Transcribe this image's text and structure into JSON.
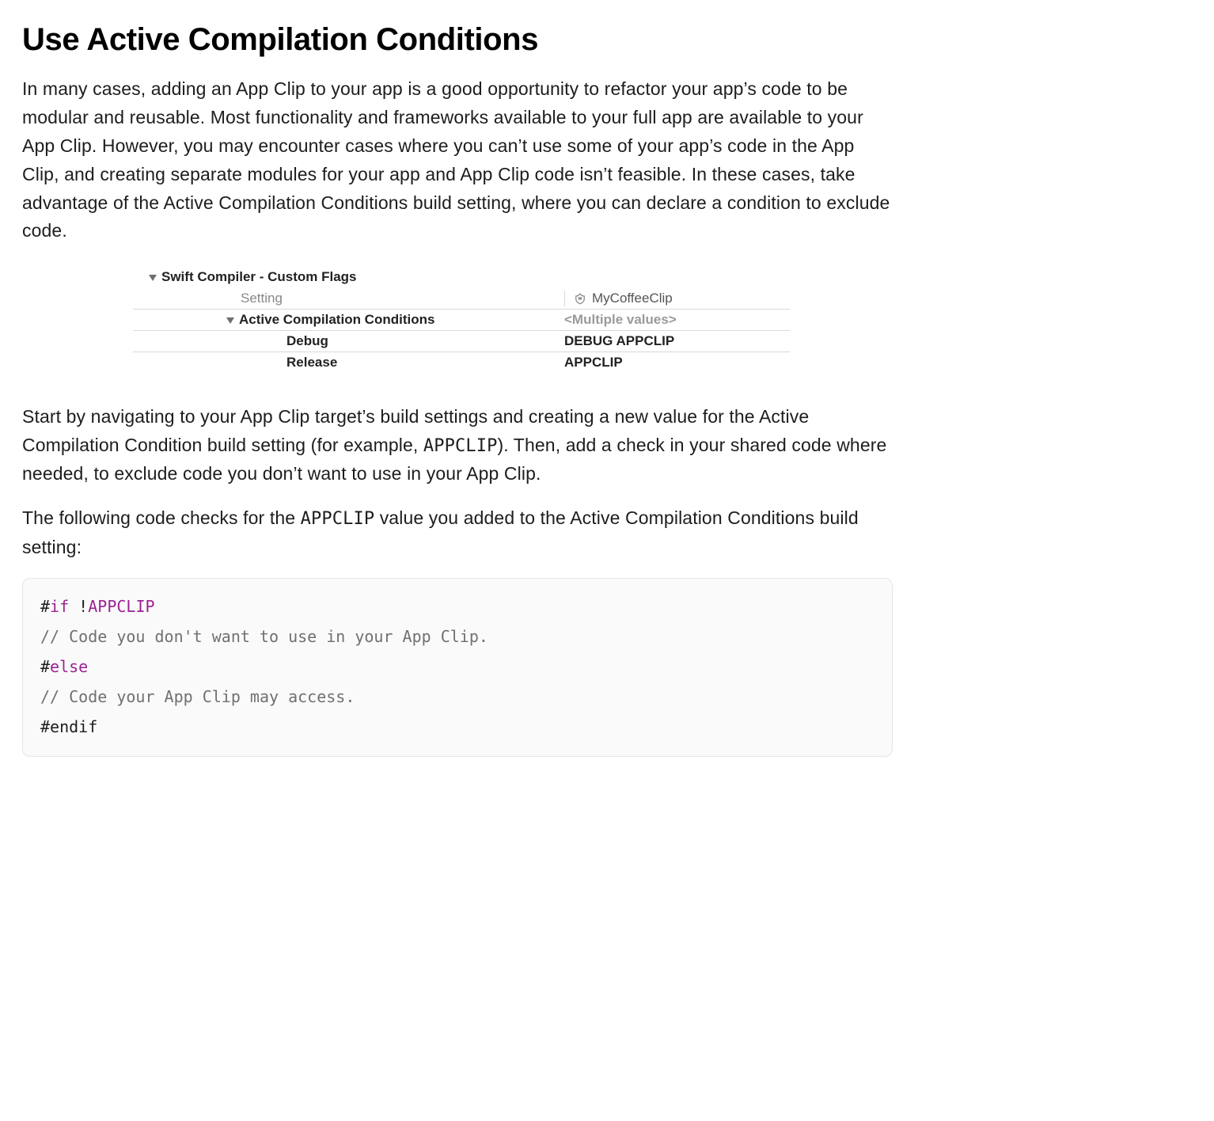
{
  "heading": "Use Active Compilation Conditions",
  "para1": "In many cases, adding an App Clip to your app is a good opportunity to refactor your app’s code to be modular and reusable. Most functionality and frameworks available to your full app are available to your App Clip. However, you may encounter cases where you can’t use some of your app’s code in the App Clip, and creating separate modules for your app and App Clip code isn’t feasible. In these cases, take advantage of the Active Compilation Conditions build setting, where you can declare a condition to exclude code.",
  "build_settings": {
    "group_title": "Swift Compiler - Custom Flags",
    "column_label": "Setting",
    "target_name": "MyCoffeeClip",
    "subgroup_title": "Active Compilation Conditions",
    "subgroup_value": "<Multiple values>",
    "rows": [
      {
        "label": "Debug",
        "value": "DEBUG APPCLIP"
      },
      {
        "label": "Release",
        "value": "APPCLIP"
      }
    ]
  },
  "para2_pre": "Start by navigating to your App Clip target’s build settings and creating a new value for the Active Compilation Condition build setting (for example, ",
  "para2_code": "APPCLIP",
  "para2_post": "). Then, add a check in your shared code where needed, to exclude code you don’t want to use in your App Clip.",
  "para3_pre": "The following code checks for the ",
  "para3_code": "APPCLIP",
  "para3_post": " value you added to the Active Compilation Conditions build setting:",
  "code": {
    "l1_hash": "#",
    "l1_kw": "if",
    "l1_rest": " !",
    "l1_sym": "APPCLIP",
    "l2": "// Code you don't want to use in your App Clip.",
    "l3_hash": "#",
    "l3_kw": "else",
    "l4": "// Code your App Clip may access.",
    "l5": "#endif"
  }
}
